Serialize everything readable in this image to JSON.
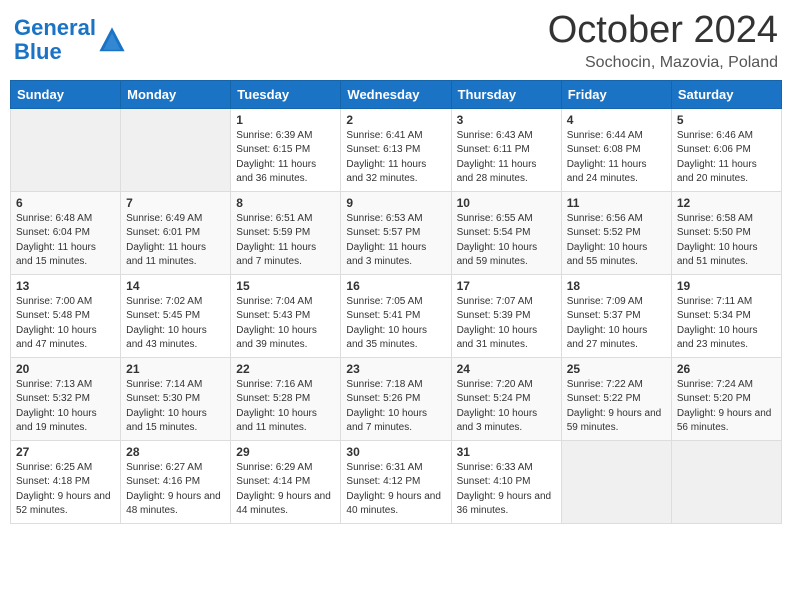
{
  "logo": {
    "line1": "General",
    "line2": "Blue"
  },
  "title": "October 2024",
  "location": "Sochocin, Mazovia, Poland",
  "days_of_week": [
    "Sunday",
    "Monday",
    "Tuesday",
    "Wednesday",
    "Thursday",
    "Friday",
    "Saturday"
  ],
  "weeks": [
    [
      {
        "day": "",
        "info": ""
      },
      {
        "day": "",
        "info": ""
      },
      {
        "day": "1",
        "info": "Sunrise: 6:39 AM\nSunset: 6:15 PM\nDaylight: 11 hours and 36 minutes."
      },
      {
        "day": "2",
        "info": "Sunrise: 6:41 AM\nSunset: 6:13 PM\nDaylight: 11 hours and 32 minutes."
      },
      {
        "day": "3",
        "info": "Sunrise: 6:43 AM\nSunset: 6:11 PM\nDaylight: 11 hours and 28 minutes."
      },
      {
        "day": "4",
        "info": "Sunrise: 6:44 AM\nSunset: 6:08 PM\nDaylight: 11 hours and 24 minutes."
      },
      {
        "day": "5",
        "info": "Sunrise: 6:46 AM\nSunset: 6:06 PM\nDaylight: 11 hours and 20 minutes."
      }
    ],
    [
      {
        "day": "6",
        "info": "Sunrise: 6:48 AM\nSunset: 6:04 PM\nDaylight: 11 hours and 15 minutes."
      },
      {
        "day": "7",
        "info": "Sunrise: 6:49 AM\nSunset: 6:01 PM\nDaylight: 11 hours and 11 minutes."
      },
      {
        "day": "8",
        "info": "Sunrise: 6:51 AM\nSunset: 5:59 PM\nDaylight: 11 hours and 7 minutes."
      },
      {
        "day": "9",
        "info": "Sunrise: 6:53 AM\nSunset: 5:57 PM\nDaylight: 11 hours and 3 minutes."
      },
      {
        "day": "10",
        "info": "Sunrise: 6:55 AM\nSunset: 5:54 PM\nDaylight: 10 hours and 59 minutes."
      },
      {
        "day": "11",
        "info": "Sunrise: 6:56 AM\nSunset: 5:52 PM\nDaylight: 10 hours and 55 minutes."
      },
      {
        "day": "12",
        "info": "Sunrise: 6:58 AM\nSunset: 5:50 PM\nDaylight: 10 hours and 51 minutes."
      }
    ],
    [
      {
        "day": "13",
        "info": "Sunrise: 7:00 AM\nSunset: 5:48 PM\nDaylight: 10 hours and 47 minutes."
      },
      {
        "day": "14",
        "info": "Sunrise: 7:02 AM\nSunset: 5:45 PM\nDaylight: 10 hours and 43 minutes."
      },
      {
        "day": "15",
        "info": "Sunrise: 7:04 AM\nSunset: 5:43 PM\nDaylight: 10 hours and 39 minutes."
      },
      {
        "day": "16",
        "info": "Sunrise: 7:05 AM\nSunset: 5:41 PM\nDaylight: 10 hours and 35 minutes."
      },
      {
        "day": "17",
        "info": "Sunrise: 7:07 AM\nSunset: 5:39 PM\nDaylight: 10 hours and 31 minutes."
      },
      {
        "day": "18",
        "info": "Sunrise: 7:09 AM\nSunset: 5:37 PM\nDaylight: 10 hours and 27 minutes."
      },
      {
        "day": "19",
        "info": "Sunrise: 7:11 AM\nSunset: 5:34 PM\nDaylight: 10 hours and 23 minutes."
      }
    ],
    [
      {
        "day": "20",
        "info": "Sunrise: 7:13 AM\nSunset: 5:32 PM\nDaylight: 10 hours and 19 minutes."
      },
      {
        "day": "21",
        "info": "Sunrise: 7:14 AM\nSunset: 5:30 PM\nDaylight: 10 hours and 15 minutes."
      },
      {
        "day": "22",
        "info": "Sunrise: 7:16 AM\nSunset: 5:28 PM\nDaylight: 10 hours and 11 minutes."
      },
      {
        "day": "23",
        "info": "Sunrise: 7:18 AM\nSunset: 5:26 PM\nDaylight: 10 hours and 7 minutes."
      },
      {
        "day": "24",
        "info": "Sunrise: 7:20 AM\nSunset: 5:24 PM\nDaylight: 10 hours and 3 minutes."
      },
      {
        "day": "25",
        "info": "Sunrise: 7:22 AM\nSunset: 5:22 PM\nDaylight: 9 hours and 59 minutes."
      },
      {
        "day": "26",
        "info": "Sunrise: 7:24 AM\nSunset: 5:20 PM\nDaylight: 9 hours and 56 minutes."
      }
    ],
    [
      {
        "day": "27",
        "info": "Sunrise: 6:25 AM\nSunset: 4:18 PM\nDaylight: 9 hours and 52 minutes."
      },
      {
        "day": "28",
        "info": "Sunrise: 6:27 AM\nSunset: 4:16 PM\nDaylight: 9 hours and 48 minutes."
      },
      {
        "day": "29",
        "info": "Sunrise: 6:29 AM\nSunset: 4:14 PM\nDaylight: 9 hours and 44 minutes."
      },
      {
        "day": "30",
        "info": "Sunrise: 6:31 AM\nSunset: 4:12 PM\nDaylight: 9 hours and 40 minutes."
      },
      {
        "day": "31",
        "info": "Sunrise: 6:33 AM\nSunset: 4:10 PM\nDaylight: 9 hours and 36 minutes."
      },
      {
        "day": "",
        "info": ""
      },
      {
        "day": "",
        "info": ""
      }
    ]
  ]
}
